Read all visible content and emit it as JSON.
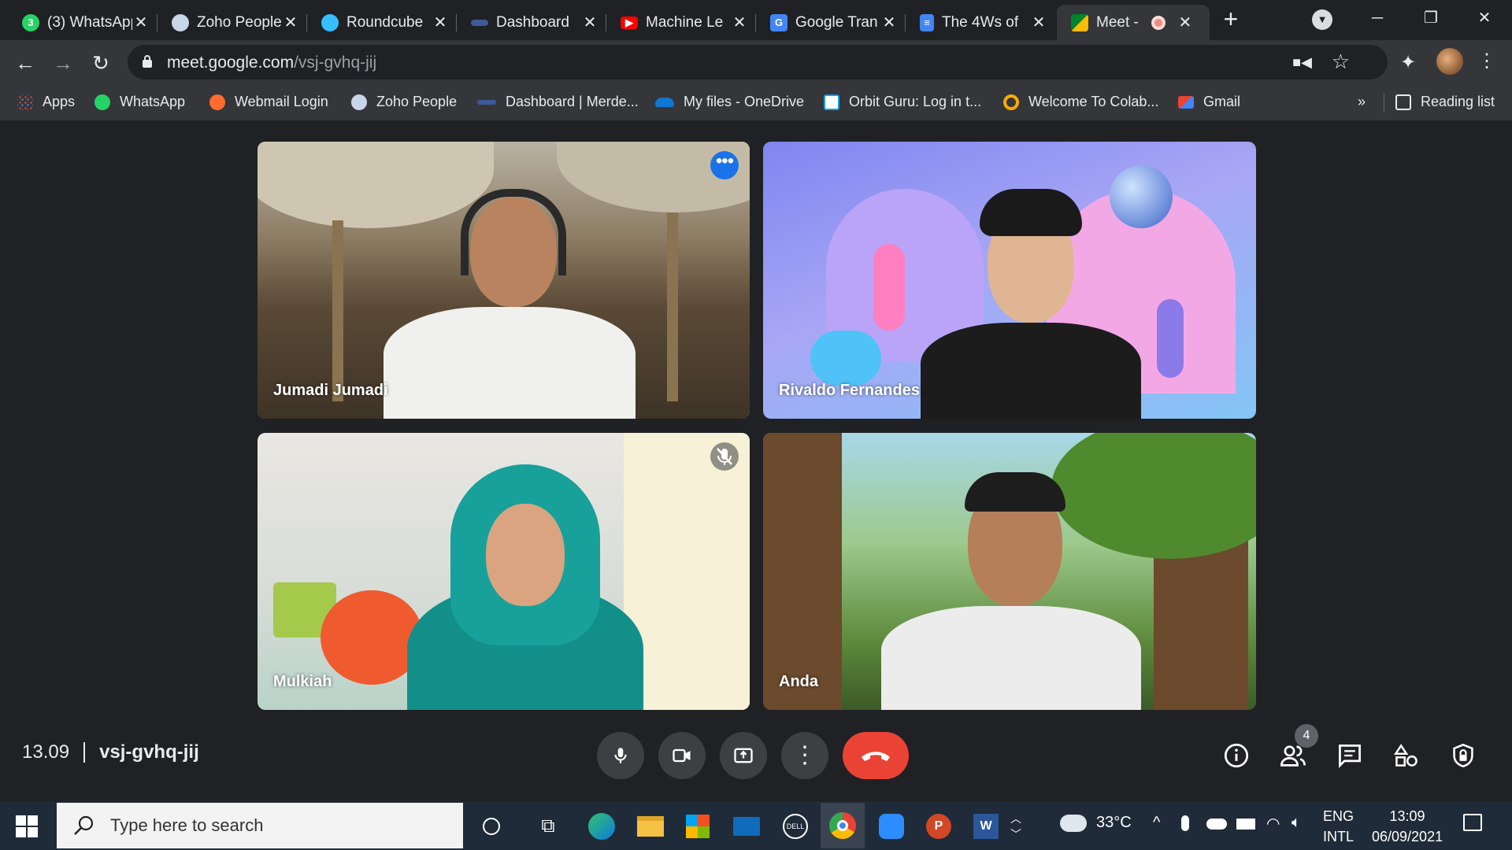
{
  "browser": {
    "tabs": [
      {
        "title": "(3) WhatsApp",
        "favicon": "whatsapp-icon",
        "color": "#25d366",
        "badge": "3"
      },
      {
        "title": "Zoho People",
        "favicon": "zoho-people-icon",
        "color": "#e8eaed"
      },
      {
        "title": "Roundcube",
        "favicon": "roundcube-icon",
        "color": "#37beff"
      },
      {
        "title": "Dashboard",
        "favicon": "dashboard-icon",
        "color": "#3d5a99"
      },
      {
        "title": "Machine Le",
        "favicon": "youtube-icon",
        "color": "#ff0000"
      },
      {
        "title": "Google Tran",
        "favicon": "google-translate-icon",
        "color": "#4285f4"
      },
      {
        "title": "The 4Ws of",
        "favicon": "google-docs-icon",
        "color": "#4285f4"
      },
      {
        "title": "Meet -",
        "favicon": "google-meet-icon",
        "color": "#00832d",
        "active": true,
        "recording": true
      }
    ],
    "url_host": "meet.google.com",
    "url_path": "/vsj-gvhq-jij",
    "bookmarks": [
      {
        "label": "Apps",
        "icon": "apps-grid-icon",
        "color": "#ea4335"
      },
      {
        "label": "WhatsApp",
        "icon": "whatsapp-icon",
        "color": "#25d366"
      },
      {
        "label": "Webmail Login",
        "icon": "cpanel-icon",
        "color": "#ff6c2c"
      },
      {
        "label": "Zoho People",
        "icon": "zoho-people-icon",
        "color": "#e8eaed"
      },
      {
        "label": "Dashboard | Merde...",
        "icon": "dashboard-icon",
        "color": "#3d5a99"
      },
      {
        "label": "My files - OneDrive",
        "icon": "onedrive-icon",
        "color": "#0f78d4"
      },
      {
        "label": "Orbit Guru: Log in t...",
        "icon": "orbit-guru-icon",
        "color": "#1a9be8"
      },
      {
        "label": "Welcome To Colab...",
        "icon": "colab-icon",
        "color": "#f9ab00"
      },
      {
        "label": "Gmail",
        "icon": "gmail-icon",
        "color": "#ea4335"
      }
    ],
    "bookmarks_more": "»",
    "reading_list": "Reading list"
  },
  "meet": {
    "participants": [
      {
        "name": "Jumadi Jumadi",
        "speaking": true
      },
      {
        "name": "Rivaldo Fernandes"
      },
      {
        "name": "Mulkiah",
        "muted": true
      },
      {
        "name": "Anda"
      }
    ],
    "time": "13.09",
    "meeting_code": "vsj-gvhq-jij",
    "participant_count": "4",
    "accent": "#8ab4f8",
    "end_call_color": "#ea4335"
  },
  "taskbar": {
    "search_placeholder": "Type here to search",
    "temperature": "33°C",
    "lang_top": "ENG",
    "lang_bottom": "INTL",
    "clock_time": "13:09",
    "clock_date": "06/09/2021"
  }
}
